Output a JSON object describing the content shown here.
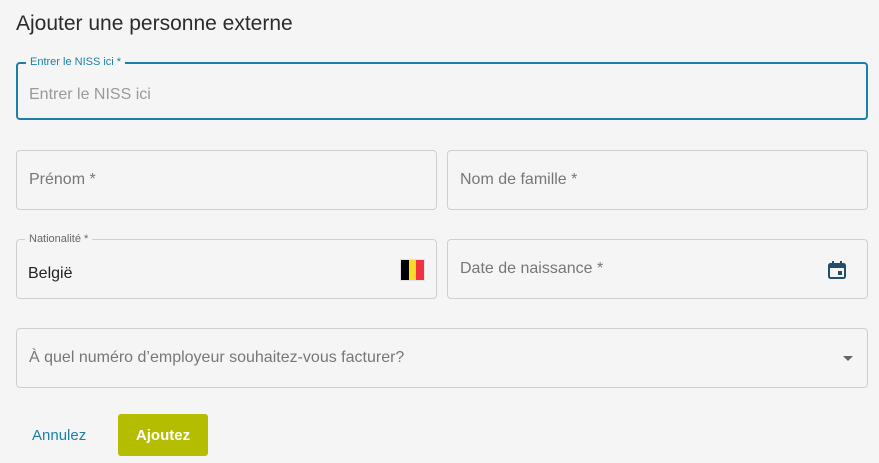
{
  "dialog": {
    "title": "Ajouter une personne externe"
  },
  "niss": {
    "label": "Entrer le NISS ici *",
    "placeholder": "Entrer le NISS ici",
    "value": ""
  },
  "firstname": {
    "placeholder": "Prénom *"
  },
  "lastname": {
    "placeholder": "Nom de famille *"
  },
  "nationality": {
    "label": "Nationalité *",
    "value": "België",
    "flag_icon": "belgium-flag-icon",
    "flag_colors": [
      "#000000",
      "#fdda24",
      "#ef3340"
    ]
  },
  "birthdate": {
    "placeholder": "Date de naissance *",
    "icon": "calendar-icon"
  },
  "employer": {
    "placeholder": "À quel numéro d’employeur souhaitez-vous facturer?",
    "icon": "chevron-down-icon"
  },
  "actions": {
    "cancel_label": "Annulez",
    "submit_label": "Ajoutez"
  },
  "colors": {
    "accent": "#1b7fa6",
    "primary_button": "#b5bd00",
    "calendar_icon": "#1f4e6e"
  }
}
